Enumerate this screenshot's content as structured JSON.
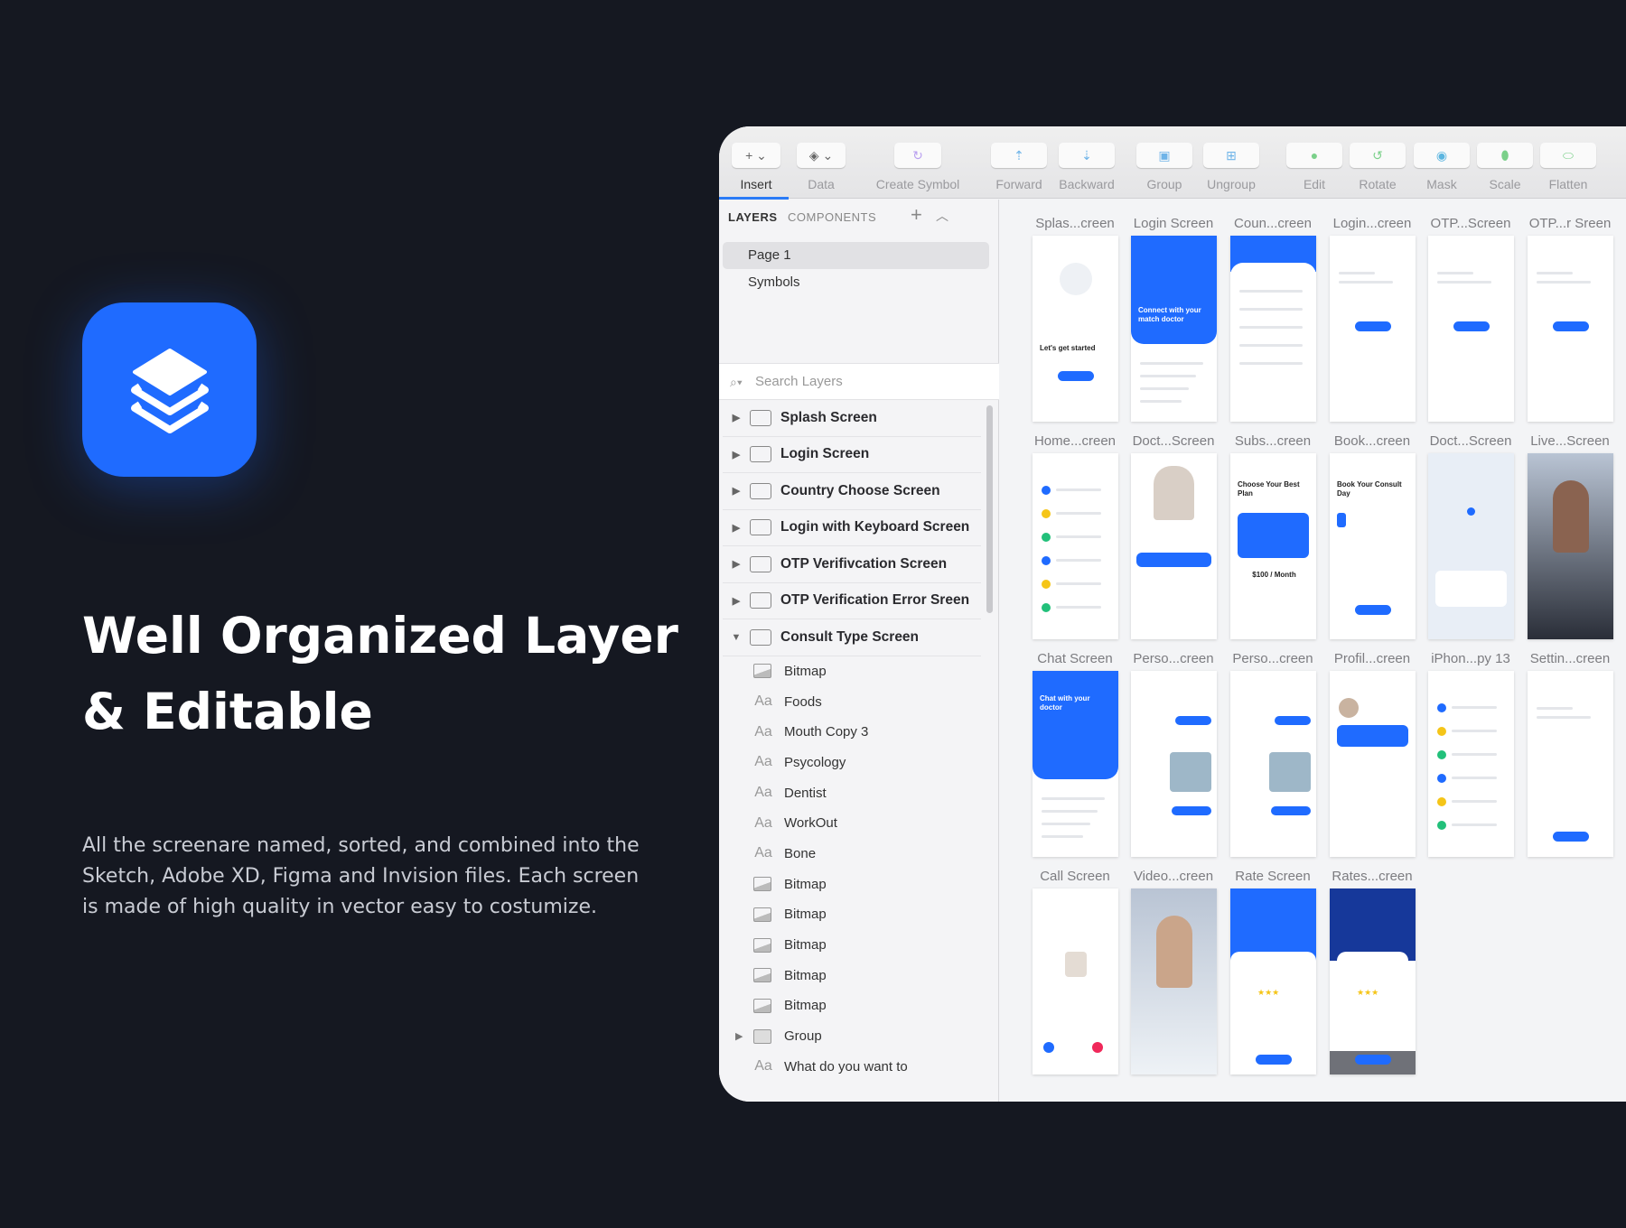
{
  "hero": {
    "title_line1": "Well Organized Layer",
    "title_line2": "& Editable",
    "description": "All the screenare named, sorted, and combined into the Sketch, Adobe XD, Figma and Invision files. Each screen is made of high quality in vector easy to costumize.",
    "icon": "layers-stack-icon",
    "accent": "#1f6bff"
  },
  "toolbar": {
    "items": [
      {
        "label": "Insert",
        "icon": "plus-icon",
        "active": true
      },
      {
        "label": "Data",
        "icon": "layers-icon"
      },
      {
        "label": "Create Symbol",
        "icon": "symbol-icon"
      },
      {
        "label": "Forward",
        "icon": "forward-icon"
      },
      {
        "label": "Backward",
        "icon": "backward-icon"
      },
      {
        "label": "Group",
        "icon": "group-icon"
      },
      {
        "label": "Ungroup",
        "icon": "ungroup-icon"
      },
      {
        "label": "Edit",
        "icon": "edit-icon"
      },
      {
        "label": "Rotate",
        "icon": "rotate-icon"
      },
      {
        "label": "Mask",
        "icon": "mask-icon"
      },
      {
        "label": "Scale",
        "icon": "scale-icon"
      },
      {
        "label": "Flatten",
        "icon": "flatten-icon"
      }
    ]
  },
  "sidebar": {
    "tabs": [
      "LAYERS",
      "COMPONENTS"
    ],
    "pages": [
      "Page 1",
      "Symbols"
    ],
    "search_placeholder": "Search Layers",
    "artboards": [
      "Splash Screen",
      "Login Screen",
      "Country Choose Screen",
      "Login with Keyboard Screen",
      "OTP Verifivcation Screen",
      "OTP Verification Error Sreen",
      "Consult Type Screen"
    ],
    "children": [
      {
        "type": "bitmap",
        "label": "Bitmap"
      },
      {
        "type": "text",
        "label": "Foods"
      },
      {
        "type": "text",
        "label": "Mouth Copy 3"
      },
      {
        "type": "text",
        "label": "Psycology"
      },
      {
        "type": "text",
        "label": "Dentist"
      },
      {
        "type": "text",
        "label": "WorkOut"
      },
      {
        "type": "text",
        "label": "Bone"
      },
      {
        "type": "bitmap",
        "label": "Bitmap"
      },
      {
        "type": "bitmap",
        "label": "Bitmap"
      },
      {
        "type": "bitmap",
        "label": "Bitmap"
      },
      {
        "type": "bitmap",
        "label": "Bitmap"
      },
      {
        "type": "bitmap",
        "label": "Bitmap"
      },
      {
        "type": "group",
        "label": "Group"
      },
      {
        "type": "text",
        "label": "What do you want to"
      }
    ],
    "text_icon": "Aa"
  },
  "canvas": {
    "artboards": [
      [
        {
          "label": "Splas...creen",
          "theme": "white",
          "headline": "Let's get started"
        },
        {
          "label": "Login Screen",
          "theme": "blue",
          "headline": "Connect with your match doctor"
        },
        {
          "label": "Coun...creen",
          "theme": "blue-short"
        },
        {
          "label": "Login...creen",
          "theme": "white-button"
        },
        {
          "label": "OTP...Screen",
          "theme": "white-button"
        },
        {
          "label": "OTP...r Sreen",
          "theme": "white-button"
        }
      ],
      [
        {
          "label": "Home...creen",
          "theme": "list"
        },
        {
          "label": "Doct...Screen",
          "theme": "profile"
        },
        {
          "label": "Subs...creen",
          "theme": "plan",
          "headline": "Choose Your Best Plan",
          "price": "$100 / Month"
        },
        {
          "label": "Book...creen",
          "theme": "book",
          "headline": "Book Your Consult Day"
        },
        {
          "label": "Doct...Screen",
          "theme": "map"
        },
        {
          "label": "Live...Screen",
          "theme": "dark"
        }
      ],
      [
        {
          "label": "Chat Screen",
          "theme": "blue",
          "headline": "Chat with your doctor"
        },
        {
          "label": "Perso...creen",
          "theme": "chat"
        },
        {
          "label": "Perso...creen",
          "theme": "chat"
        },
        {
          "label": "Profil...creen",
          "theme": "profile-card"
        },
        {
          "label": "iPhon...py 13",
          "theme": "list"
        },
        {
          "label": "Settin...creen",
          "theme": "white-button"
        }
      ],
      [
        {
          "label": "Call Screen",
          "theme": "call"
        },
        {
          "label": "Video...creen",
          "theme": "video"
        },
        {
          "label": "Rate Screen",
          "theme": "rate"
        },
        {
          "label": "Rates...creen",
          "theme": "rate-dark"
        }
      ]
    ]
  }
}
